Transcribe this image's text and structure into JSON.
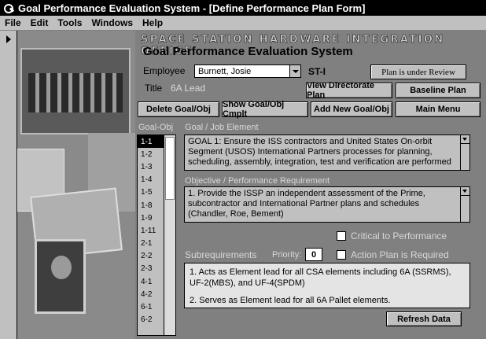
{
  "window": {
    "title": "Goal Performance Evaluation System - [Define Performance Plan Form]"
  },
  "menu": [
    "File",
    "Edit",
    "Tools",
    "Windows",
    "Help"
  ],
  "header": {
    "office": "SPACE STATION HARDWARE INTEGRATION OFFICE",
    "system": "Goal Performance Evaluation System"
  },
  "employee": {
    "label": "Employee",
    "value": "Burnett, Josie",
    "grade": "ST-I",
    "title_label": "Title",
    "title_value": "6A Lead"
  },
  "status": "Plan is under Review",
  "buttons": {
    "view_directorate": "View Directorate Plan",
    "baseline": "Baseline Plan",
    "delete": "Delete Goal/Obj",
    "show": "Show Goal/Obj Cmplt",
    "add": "Add New Goal/Obj",
    "main_menu": "Main Menu",
    "refresh": "Refresh Data"
  },
  "goal_obj": {
    "label": "Goal-Obj",
    "items": [
      "1-1",
      "1-2",
      "1-3",
      "1-4",
      "1-5",
      "1-8",
      "1-9",
      "1-11",
      "2-1",
      "2-2",
      "2-3",
      "4-1",
      "4-2",
      "6-1",
      "6-2"
    ],
    "selected": "1-1"
  },
  "goal": {
    "label": "Goal / Job Element",
    "text": "GOAL 1: Ensure the ISS contractors and United States On-orbit Segment (USOS) International Partners processes for planning, scheduling, assembly, integration, test and verification are performed"
  },
  "objective": {
    "label": "Objective / Performance Requirement",
    "text": "1. Provide the ISSP an independent assessment of the Prime, subcontractor and International Partner plans and schedules (Chandler, Roe, Bement)"
  },
  "critical_label": "Critical to Performance",
  "subreq": {
    "label": "Subrequirements",
    "priority_label": "Priority:",
    "priority_value": "0",
    "action_plan_label": "Action Plan is Required",
    "text_1": "1.  Acts as Element lead for all CSA elements including 6A (SSRMS), UF-2(MBS), and UF-4(SPDM)",
    "text_2": "2.  Serves as Element lead for all 6A Pallet elements."
  }
}
